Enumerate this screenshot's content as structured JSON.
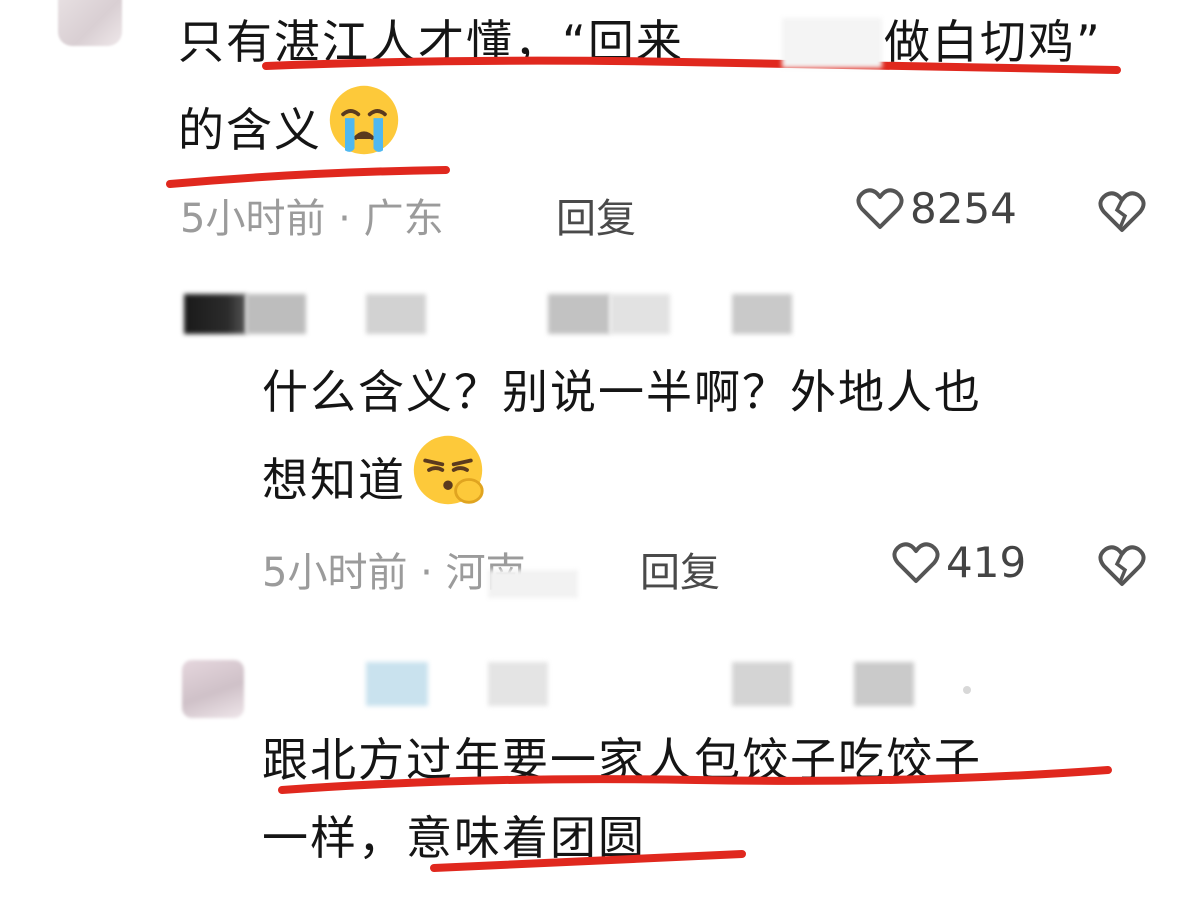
{
  "comment_1": {
    "line_1": "只有湛江人才懂，“回来",
    "line_1b": "做白切鸡”",
    "line_2": "的含义",
    "emoji": "loudly-crying-face",
    "time_location": "5小时前 · 广东",
    "reply_label": "回复",
    "like_count": "8254"
  },
  "comment_2": {
    "line_1": "什么含义？别说一半啊？外地人也",
    "line_2": "想知道",
    "emoji": "smirking-face-with-hand",
    "time_location": "5小时前 · 河南",
    "reply_label": "回复",
    "like_count": "419"
  },
  "comment_3": {
    "line_1": "跟北方过年要一家人包饺子吃饺子",
    "line_2_a": "一样，",
    "line_2_b": "意味着团圆"
  },
  "colors": {
    "underline": "#e0281e",
    "meta": "#9b9b9b",
    "text": "#151515"
  }
}
